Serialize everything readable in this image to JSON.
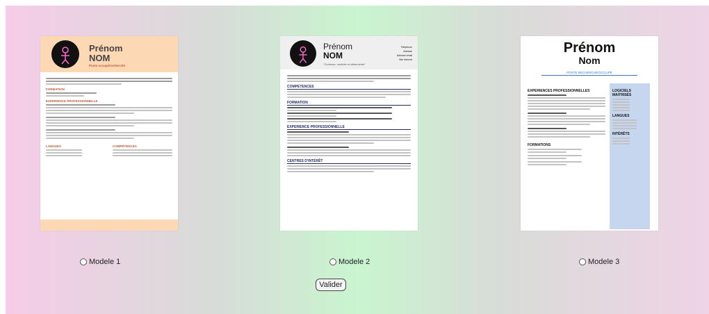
{
  "models": [
    {
      "label": "Modele 1",
      "selected": false,
      "preview": {
        "first_name": "Prénom",
        "last_name": "NOM",
        "subtitle": "Poste occupé/recherché",
        "sections": [
          "FORMATION",
          "EXPERIENCE PROFESSIONNELLE",
          "LANGUES",
          "COMPÉTENCES"
        ],
        "accent": "#fdd8b5"
      }
    },
    {
      "label": "Modele 2",
      "selected": false,
      "preview": {
        "first_name": "Prénom",
        "last_name": "NOM",
        "subtitle": "\"Curieuse, motivée et déterminée\"",
        "contact": [
          "Téléphone",
          "Adresse",
          "Adresse email",
          "Site Internet"
        ],
        "sections": [
          "COMPETENCES",
          "FORMATION",
          "EXPERIENCE PROFESSIONNELLE",
          "CENTRES D'INTÉRÊT"
        ],
        "accent": "#efefef"
      }
    },
    {
      "label": "Modele 3",
      "selected": false,
      "preview": {
        "first_name": "Prénom",
        "last_name": "Nom",
        "subtitle": "POSTE RECHERCHÉ/OCCUPÉ",
        "sections": [
          "EXPERIENCES PROFESSIONNELLES",
          "FORMATIONS"
        ],
        "side_sections": [
          "LOGICIELS MAITRISÉS",
          "LANGUES",
          "INTÉRÊTS"
        ],
        "accent": "#c5d6ee"
      }
    }
  ],
  "submit_label": "Valider"
}
